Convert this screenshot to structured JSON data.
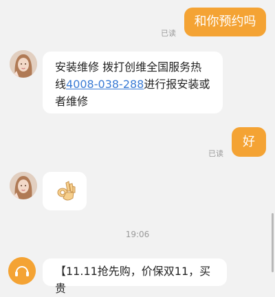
{
  "colors": {
    "accent": "#f4a334",
    "background": "#f2f2f2",
    "bubble_in": "#ffffff",
    "link": "#3a7bd5",
    "meta_text": "#9a9a9a"
  },
  "messages": {
    "out_1": {
      "text": "和你预约吗",
      "status": "已读"
    },
    "in_1": {
      "prefix": "安装维修 拨打创维全国服务热线",
      "phone": "4008-038-288",
      "suffix": "进行报安装或者维修",
      "avatar_icon": "agent-avatar-icon"
    },
    "out_2": {
      "text": "好",
      "status": "已读"
    },
    "in_2": {
      "emoji": "👌",
      "avatar_icon": "agent-avatar-icon"
    },
    "timestamp": "19:06",
    "in_3": {
      "text": "【11.11抢先购，价保双11，买贵",
      "avatar_icon": "headset-service-icon"
    }
  }
}
